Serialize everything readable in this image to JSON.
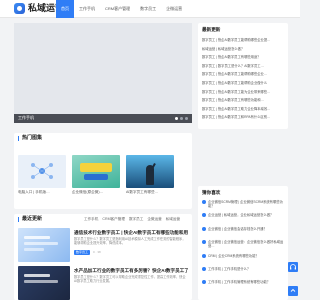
{
  "site": {
    "logo_text": "私域运营"
  },
  "nav": [
    "首页",
    "工作手机",
    "CRM客户管理",
    "数字员工",
    "企微运营"
  ],
  "banner": {
    "caption": "工作手机"
  },
  "hot": {
    "title": "热门图集",
    "items": [
      "电脑入口 | 手机版…",
      "企业微信(原企微)…",
      "AI数字员工有哪些…"
    ]
  },
  "recent": {
    "title": "最近更新",
    "tabs": [
      "工作手机",
      "CRM客户管理",
      "数字员工",
      "企微运营",
      "私域运营"
    ],
    "posts": [
      {
        "title": "通信技术行业数字员工 | 快企AI数字员工有哪些功能和用途？",
        "desc": "数字员工是什么？数字员工是指利用AI技术模拟人工完成工作任务的智能程序，能够帮助企业提升效率、降低成本。",
        "badge": "数字员工",
        "meta": "0 · 38"
      },
      {
        "title": "水产品加工行业的数字员工有多厉害？快企AI数字员工了解一下",
        "desc": "数字员工是什么？数字员工可以帮助企业完成重复性工作，提高工作效率，快企AI数字员工助力行业发展。",
        "badge": "数字员工",
        "meta": ""
      }
    ]
  },
  "side_recent": {
    "title": "最新更新",
    "items": [
      "数字员工 | 快企AI数字员工能帮助哪些企业提…",
      "私域运营 | 私域运营怎么做？",
      "数字员工 | 快企AI数字员工有哪些用途？",
      "数字员工 | 数字员工是什么？AI数字员工…",
      "数字员工 | 快企AI数字员工能帮助哪些企业…",
      "数字员工 | 快企AI数字员工能帮助企业做什么",
      "数字员工 | 快企AI数字员工能为企业带来哪些…",
      "数字员工 | 快企AI数字员工有哪些功能和…",
      "数字员工 | 快企AI数字员工助力企业降本增效…",
      "数字员工 | 快企AI数字员工和RPA有什么区别…"
    ]
  },
  "side_hot": {
    "title": "猜你喜欢",
    "items": [
      "企业微信SCRM管理 | 企业微信SCRM系统有哪些功能？",
      "企业运营 | 私域运营，企业私域运营怎么做？",
      "企业微信 | 企业微信会话存档怎么开通？",
      "企业微信 | 企业微信运营：企业微信怎么做好私域运营…",
      "CRM | 企业CRM系统有哪些功能？",
      "工作手机 | 工作手机是什么？",
      "工作手机 | 工作手机管理系统有哪些功能？",
      "私域运营 | 私域运营是什么？"
    ]
  },
  "colors": {
    "accent": "#2f7df6",
    "badge": "#2f7df6",
    "banner_bar": "#4a4d55"
  },
  "icons": {
    "float_top": "arrow-up-icon",
    "float_service": "headset-icon"
  }
}
